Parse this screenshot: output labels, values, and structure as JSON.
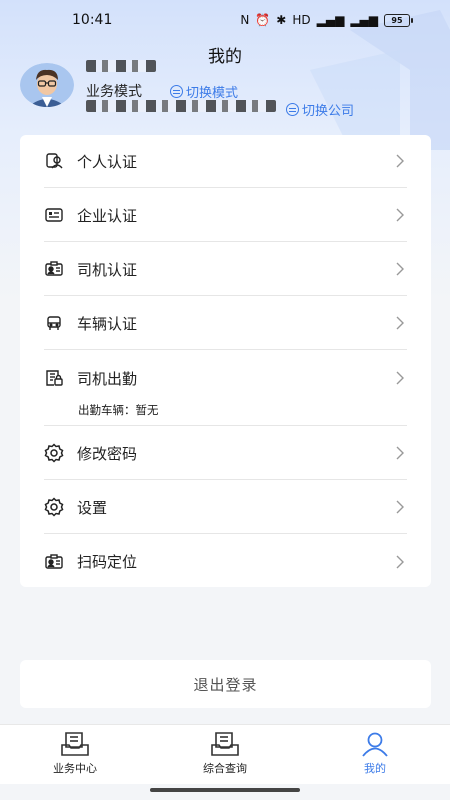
{
  "status": {
    "time": "10:41",
    "battery": "95"
  },
  "header": {
    "title": "我的",
    "mode_label": "业务模式",
    "switch_mode": "切换模式",
    "switch_company": "切换公司"
  },
  "menu": {
    "items": [
      {
        "label": "个人认证",
        "icon": "person-id-icon"
      },
      {
        "label": "企业认证",
        "icon": "company-card-icon"
      },
      {
        "label": "司机认证",
        "icon": "driver-license-icon"
      },
      {
        "label": "车辆认证",
        "icon": "vehicle-icon"
      },
      {
        "label": "司机出勤",
        "icon": "attendance-icon",
        "sub": "出勤车辆：暂无"
      },
      {
        "label": "修改密码",
        "icon": "gear-icon"
      },
      {
        "label": "设置",
        "icon": "gear-icon"
      },
      {
        "label": "扫码定位",
        "icon": "scan-locate-icon"
      }
    ]
  },
  "logout_label": "退出登录",
  "tabs": [
    {
      "label": "业务中心",
      "icon": "business-center-icon"
    },
    {
      "label": "综合查询",
      "icon": "query-icon"
    },
    {
      "label": "我的",
      "icon": "profile-icon",
      "active": true
    }
  ],
  "colors": {
    "accent": "#3c7be8",
    "card": "#ffffff",
    "page_bg": "#f3f5f8"
  }
}
